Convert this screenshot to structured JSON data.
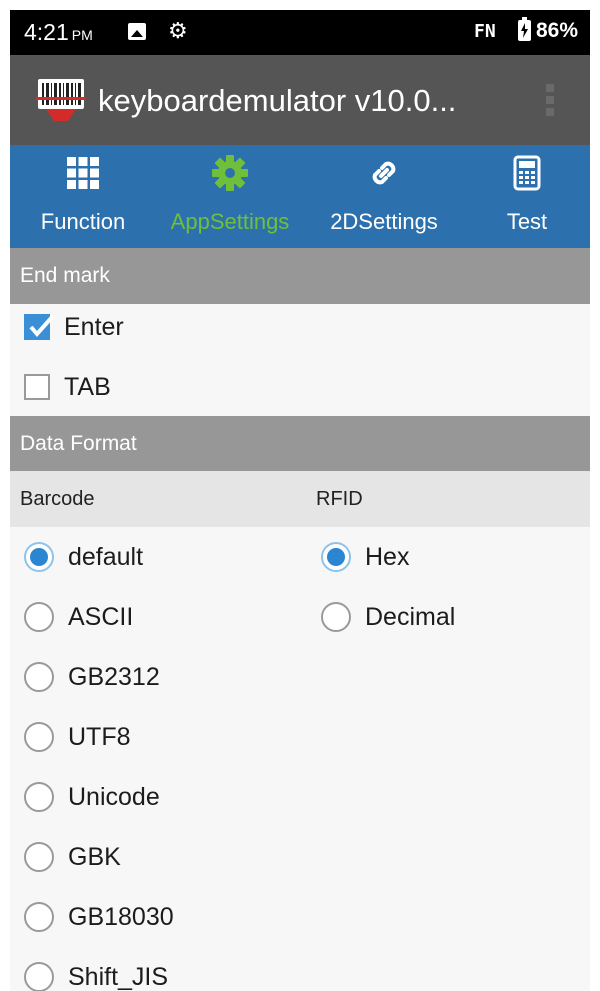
{
  "status_bar": {
    "time": "4:21",
    "ampm": "PM",
    "fn_label": "FN",
    "battery": "86%",
    "icons": [
      "image-icon",
      "gear-icon",
      "battery-charging-icon"
    ]
  },
  "app_bar": {
    "title": "keyboardemulator v10.0...",
    "logo": "barcode-scanner-logo",
    "overflow": "more-vert-icon"
  },
  "tabs": [
    {
      "label": "Function",
      "icon": "grid-icon",
      "active": false
    },
    {
      "label": "AppSettings",
      "icon": "gear-icon",
      "active": true
    },
    {
      "label": "2DSettings",
      "icon": "link-icon",
      "active": false
    },
    {
      "label": "Test",
      "icon": "calculator-icon",
      "active": false
    }
  ],
  "end_mark": {
    "header": "End mark",
    "options": [
      {
        "label": "Enter",
        "checked": true
      },
      {
        "label": "TAB",
        "checked": false
      }
    ]
  },
  "data_format": {
    "header": "Data Format",
    "barcode": {
      "header": "Barcode",
      "selected": "default",
      "options": [
        "default",
        "ASCII",
        "GB2312",
        "UTF8",
        "Unicode",
        "GBK",
        "GB18030",
        "Shift_JIS"
      ]
    },
    "rfid": {
      "header": "RFID",
      "selected": "Hex",
      "options": [
        "Hex",
        "Decimal"
      ]
    }
  },
  "colors": {
    "tab_bar": "#2c71ad",
    "active_tab": "#6fbf3a",
    "app_bar": "#555555",
    "section_header": "#979797",
    "radio_selected": "#2a86d0"
  }
}
